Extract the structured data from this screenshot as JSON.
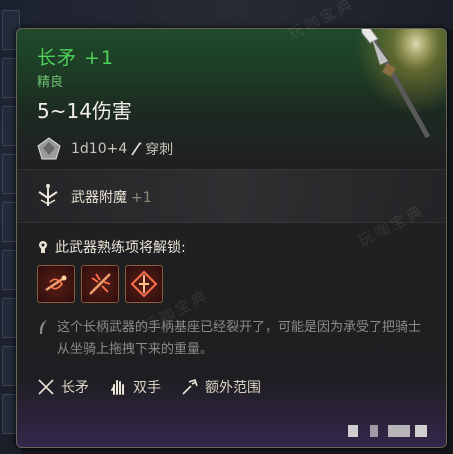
{
  "item": {
    "name": "长矛 +1",
    "rarity": "精良",
    "damage": "5~14伤害",
    "dice": "1d10+4",
    "damage_type": "穿刺"
  },
  "enchantment": {
    "label": "武器附魔",
    "bonus": "+1"
  },
  "mastery": {
    "unlock_label": "此武器熟练项将解锁:",
    "actions": [
      {
        "icon": "shaft-action-icon"
      },
      {
        "icon": "fury-strike-icon"
      },
      {
        "icon": "piercing-strike-icon"
      }
    ]
  },
  "description": "这个长柄武器的手柄基座已经裂开了，可能是因为承受了把骑士从坐骑上拖拽下来的重量。",
  "properties": [
    {
      "icon": "spear-icon",
      "label": "长矛"
    },
    {
      "icon": "two-handed-icon",
      "label": "双手"
    },
    {
      "icon": "reach-icon",
      "label": "额外范围"
    }
  ],
  "watermarks": [
    "玩咖宝典",
    "玩咖宝典",
    "玩咖宝典"
  ],
  "colors": {
    "name": "#4fd05a",
    "rarity": "#6fbf70",
    "header_gradient": "#1f4a2a",
    "action_border": "#8a5a3a"
  }
}
